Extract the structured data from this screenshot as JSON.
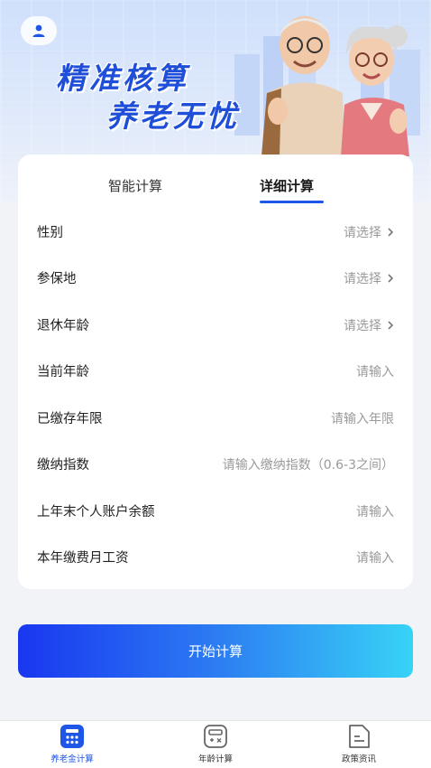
{
  "hero": {
    "slogan_line1": "精准核算",
    "slogan_line2": "养老无忧",
    "accent_color": "#1f4fd8"
  },
  "tabs": [
    {
      "label": "智能计算",
      "active": false
    },
    {
      "label": "详细计算",
      "active": true
    }
  ],
  "form": {
    "rows": [
      {
        "label": "性别",
        "value": "请选择",
        "chevron": true
      },
      {
        "label": "参保地",
        "value": "请选择",
        "chevron": true
      },
      {
        "label": "退休年龄",
        "value": "请选择",
        "chevron": true
      },
      {
        "label": "当前年龄",
        "value": "请输入",
        "chevron": false
      },
      {
        "label": "已缴存年限",
        "value": "请输入年限",
        "chevron": false
      },
      {
        "label": "缴纳指数",
        "value": "请输入缴纳指数（0.6-3之间）",
        "chevron": false
      },
      {
        "label": "上年末个人账户余额",
        "value": "请输入",
        "chevron": false
      },
      {
        "label": "本年缴费月工资",
        "value": "请输入",
        "chevron": false
      }
    ]
  },
  "start_button": {
    "label": "开始计算"
  },
  "bottom_nav": [
    {
      "label": "养老金计算",
      "icon": "calculator-icon",
      "active": true
    },
    {
      "label": "年龄计算",
      "icon": "age-calc-icon",
      "active": false
    },
    {
      "label": "政策资讯",
      "icon": "document-icon",
      "active": false
    }
  ]
}
